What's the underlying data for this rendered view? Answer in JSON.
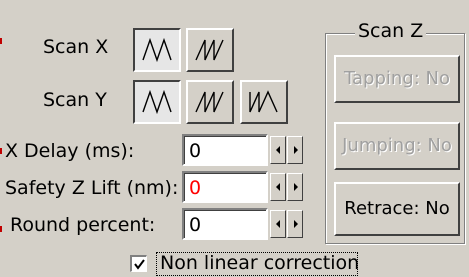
{
  "scan_x": {
    "label": "Scan X"
  },
  "scan_y": {
    "label": "Scan Y"
  },
  "x_delay": {
    "label": "X Delay (ms):",
    "value": "0"
  },
  "safety_z_lift": {
    "label": "Safety Z Lift (nm):",
    "value": "0",
    "value_color": "#ff0000"
  },
  "round_percent": {
    "label": "Round percent:",
    "value": "0"
  },
  "scan_z": {
    "title": "Scan Z",
    "tapping_label": "Tapping: No",
    "jumping_label": "Jumping: No",
    "retrace_label": "Retrace: No"
  },
  "nonlinear": {
    "label": "Non linear correction",
    "checked": true
  },
  "icons": {
    "scan_mode_a": "triangle-wave-icon",
    "scan_mode_b": "sawtooth-forward-icon",
    "scan_mode_c": "sawtooth-reverse-icon",
    "spin_left": "spin-left-arrow-icon",
    "spin_right": "spin-right-arrow-icon",
    "checkmark": "checkmark-icon"
  }
}
